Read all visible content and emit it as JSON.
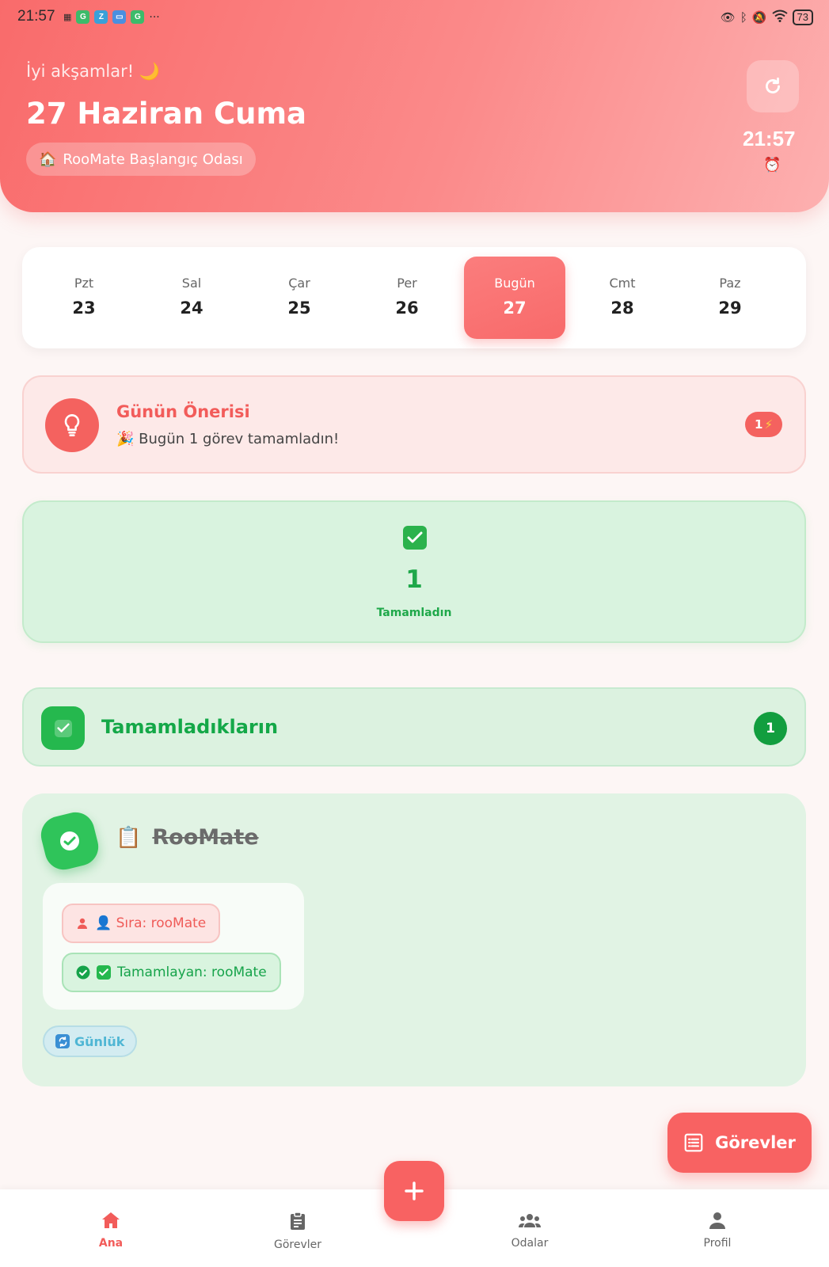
{
  "statusbar": {
    "time": "21:57",
    "battery": "73"
  },
  "header": {
    "greeting": "İyi akşamlar! 🌙",
    "date": "27 Haziran Cuma",
    "room": "RooMate Başlangıç Odası",
    "room_icon": "🏠",
    "time": "21:57",
    "alarm_icon": "⏰"
  },
  "week": {
    "days": [
      {
        "name": "Pzt",
        "num": "23",
        "active": false
      },
      {
        "name": "Sal",
        "num": "24",
        "active": false
      },
      {
        "name": "Çar",
        "num": "25",
        "active": false
      },
      {
        "name": "Per",
        "num": "26",
        "active": false
      },
      {
        "name": "Bugün",
        "num": "27",
        "active": true
      },
      {
        "name": "Cmt",
        "num": "28",
        "active": false
      },
      {
        "name": "Paz",
        "num": "29",
        "active": false
      }
    ]
  },
  "tip": {
    "title": "Günün Önerisi",
    "text": "🎉 Bugün 1 görev tamamladın!",
    "badge_count": "1",
    "badge_icon": "⚡"
  },
  "stats": {
    "completed_count": "1",
    "completed_label": "Tamamladın"
  },
  "completed_section": {
    "title": "Tamamladıkların",
    "count": "1"
  },
  "task": {
    "title": "RooMate",
    "clip_icon": "📋",
    "turn_label": "👤 Sıra: rooMate",
    "completed_by": "Tamamlayan: rooMate",
    "frequency": "Günlük"
  },
  "fab": {
    "tasks_label": "Görevler"
  },
  "nav": {
    "items": [
      {
        "label": "Ana",
        "active": true
      },
      {
        "label": "Görevler",
        "active": false
      },
      {
        "label": "Odalar",
        "active": false
      },
      {
        "label": "Profil",
        "active": false
      }
    ]
  },
  "colors": {
    "primary": "#f86262",
    "success": "#25b84e",
    "header_start": "#f96b6b",
    "header_end": "#fdb0b0"
  }
}
